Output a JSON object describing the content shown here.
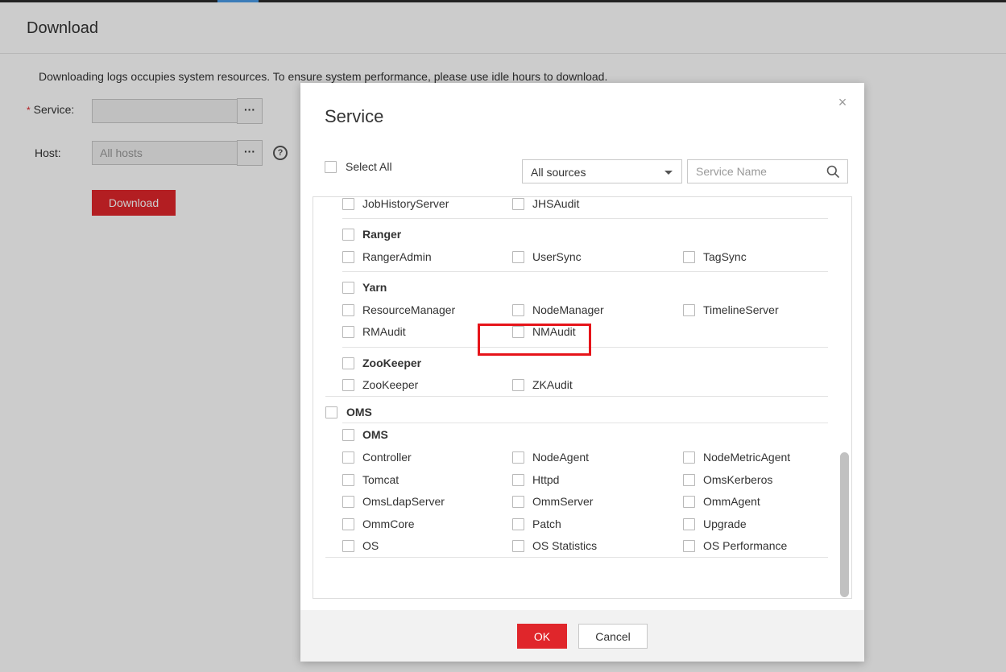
{
  "page": {
    "title": "Download",
    "notice": "Downloading logs occupies system resources. To ensure system performance, please use idle hours to download.",
    "form": {
      "required_mark": "*",
      "service_label": "Service:",
      "service_value": "",
      "host_label": "Host:",
      "host_placeholder": "All hosts",
      "browse_button": "···",
      "help_icon": "?",
      "download_button": "Download"
    }
  },
  "dialog": {
    "title": "Service",
    "close": "×",
    "select_all": "Select All",
    "source_filter": "All sources",
    "search_placeholder": "Service Name",
    "groups": [
      {
        "name": "",
        "items": [
          "JobHistoryServer",
          "JHSAudit"
        ]
      },
      {
        "name": "Ranger",
        "items": [
          "RangerAdmin",
          "UserSync",
          "TagSync"
        ]
      },
      {
        "name": "Yarn",
        "items": [
          "ResourceManager",
          "NodeManager",
          "TimelineServer",
          "RMAudit",
          "NMAudit"
        ]
      },
      {
        "name": "ZooKeeper",
        "items": [
          "ZooKeeper",
          "ZKAudit"
        ]
      }
    ],
    "top_group": "OMS",
    "oms_subgroup": {
      "name": "OMS",
      "items": [
        "Controller",
        "NodeAgent",
        "NodeMetricAgent",
        "Tomcat",
        "Httpd",
        "OmsKerberos",
        "OmsLdapServer",
        "OmmServer",
        "OmmAgent",
        "OmmCore",
        "Patch",
        "Upgrade",
        "OS",
        "OS Statistics",
        "OS Performance"
      ]
    },
    "ok_button": "OK",
    "cancel_button": "Cancel",
    "colors": {
      "primary": "#e0262b",
      "highlight": "#e6141a"
    }
  }
}
